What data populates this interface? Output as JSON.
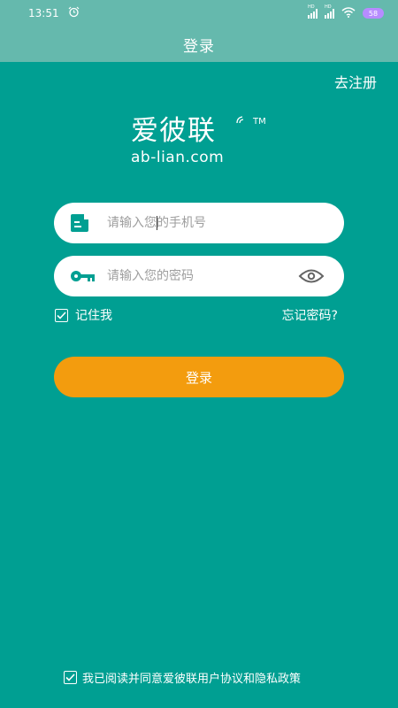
{
  "status_bar": {
    "time": "13:51",
    "alarm_icon": "alarm-clock-icon",
    "signal_tag_1": "HD",
    "signal_tag_2": "HD",
    "wifi_icon": "wifi-icon",
    "battery_level": "58"
  },
  "header": {
    "title": "登录"
  },
  "register_link": "去注册",
  "logo": {
    "name_cn": "爱彼联",
    "trademark": "TM",
    "domain": "ab-lian.com"
  },
  "form": {
    "phone": {
      "placeholder": "请输入您的手机号",
      "value": "",
      "icon": "phone-card-icon"
    },
    "password": {
      "placeholder": "请输入您的密码",
      "value": "",
      "icon": "key-icon",
      "toggle_icon": "eye-icon"
    },
    "remember_me": {
      "label": "记住我",
      "checked": true
    },
    "forgot_password": "忘记密码?",
    "submit_label": "登录"
  },
  "agreement": {
    "text": "我已阅读并同意爱彼联用户协议和隐私政策",
    "checked": true
  },
  "colors": {
    "background": "#009f92",
    "header": "#65b9ad",
    "button": "#f39c0e",
    "input_bg": "#ffffff"
  }
}
